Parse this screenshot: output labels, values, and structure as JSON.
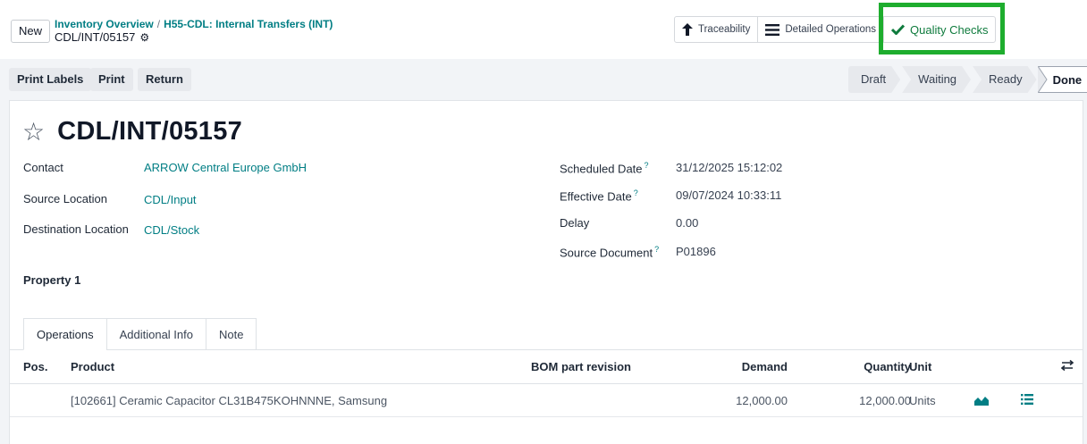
{
  "header": {
    "new_label": "New",
    "breadcrumb": [
      "Inventory Overview",
      "H55-CDL: Internal Transfers (INT)"
    ],
    "breadcrumb_sep": "/",
    "current": "CDL/INT/05157"
  },
  "smart_buttons": [
    {
      "label": "Traceability",
      "icon": "arrow-up-icon"
    },
    {
      "label": "Detailed Operations",
      "icon": "list-bars-icon"
    },
    {
      "label": "Quality Checks",
      "icon": "check-icon"
    }
  ],
  "actions": {
    "print_labels": "Print Labels",
    "print": "Print",
    "return": "Return"
  },
  "status": {
    "stages": [
      "Draft",
      "Waiting",
      "Ready",
      "Done"
    ],
    "current": "Done"
  },
  "record": {
    "title": "CDL/INT/05157",
    "contact_label": "Contact",
    "contact": "ARROW Central Europe GmbH",
    "source_location_label": "Source Location",
    "source_location": "CDL/Input",
    "destination_location_label": "Destination Location",
    "destination_location": "CDL/Stock",
    "scheduled_date_label": "Scheduled Date",
    "scheduled_date": "31/12/2025 15:12:02",
    "effective_date_label": "Effective Date",
    "effective_date": "09/07/2024 10:33:11",
    "delay_label": "Delay",
    "delay": "0.00",
    "source_document_label": "Source Document",
    "source_document": "P01896",
    "property_label": "Property 1",
    "help_mark": "?"
  },
  "tabs": [
    "Operations",
    "Additional Info",
    "Note"
  ],
  "table": {
    "columns": {
      "pos": "Pos.",
      "product": "Product",
      "bom": "BOM part revision",
      "demand": "Demand",
      "quantity": "Quantity",
      "unit": "Unit"
    },
    "rows": [
      {
        "pos": "",
        "product": "[102661] Ceramic Capacitor CL31B475KOHNNNE, Samsung",
        "bom": "",
        "demand": "12,000.00",
        "quantity": "12,000.00",
        "unit": "Units"
      }
    ]
  },
  "colors": {
    "accent": "#017e84",
    "quality": "#0f7b3d",
    "highlight": "#1ead2e"
  }
}
